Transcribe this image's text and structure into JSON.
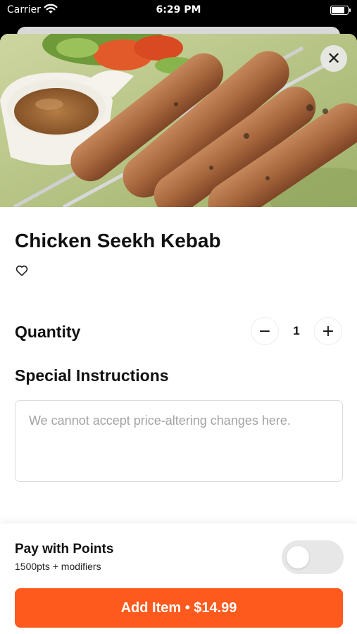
{
  "status_bar": {
    "carrier": "Carrier",
    "time": "6:29 PM",
    "wifi_icon": "wifi-icon",
    "battery_icon": "battery-icon"
  },
  "item": {
    "title": "Chicken Seekh Kebab",
    "favorite_icon": "heart-outline-icon",
    "close_icon": "close-icon",
    "image": "kebab-photo"
  },
  "quantity": {
    "label": "Quantity",
    "value": "1",
    "minus_label": "−",
    "plus_label": "+"
  },
  "instructions": {
    "label": "Special Instructions",
    "placeholder": "We cannot accept price-altering changes here.",
    "value": ""
  },
  "footer": {
    "pay_title": "Pay with Points",
    "pay_subtitle": "1500pts + modifiers",
    "toggle_on": false,
    "add_button_label": "Add Item • $14.99"
  },
  "colors": {
    "accent": "#fe5a1d",
    "toggle_off": "#e7e7e7"
  }
}
